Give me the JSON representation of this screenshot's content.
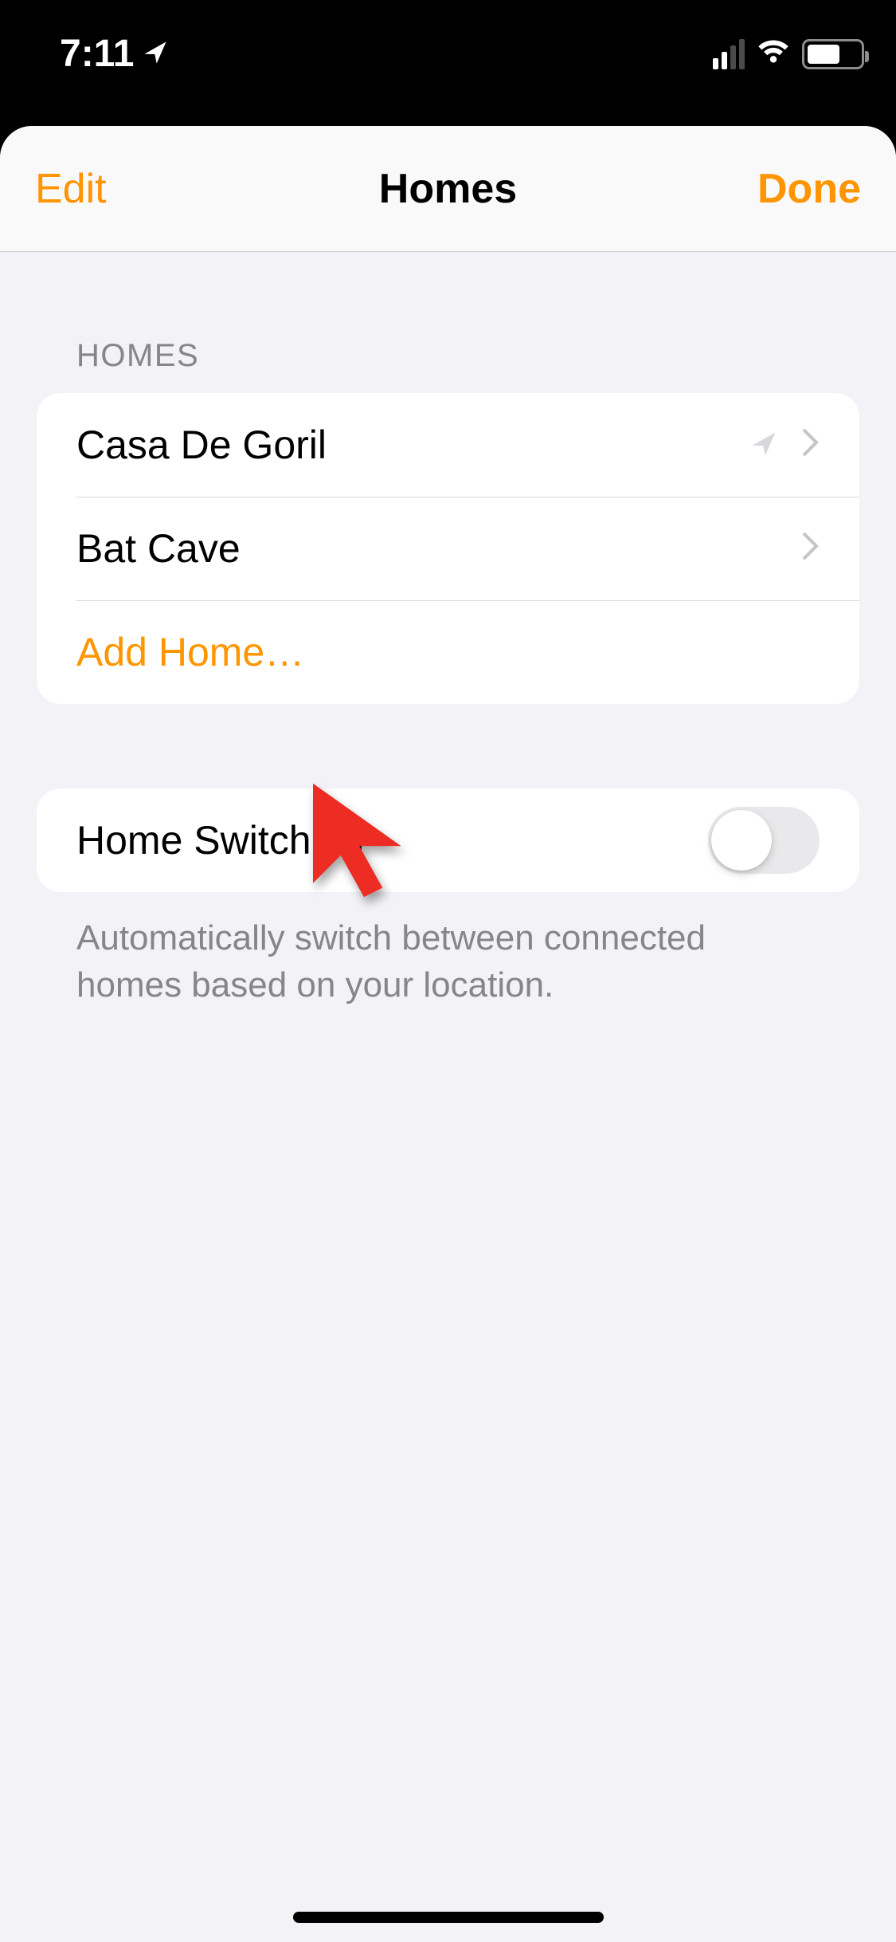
{
  "status": {
    "time": "7:11"
  },
  "nav": {
    "left": "Edit",
    "title": "Homes",
    "right": "Done"
  },
  "homes_section": {
    "header": "HOMES",
    "items": [
      {
        "label": "Casa De Goril",
        "location_indicator": true
      },
      {
        "label": "Bat Cave",
        "location_indicator": false
      }
    ],
    "add_label": "Add Home…"
  },
  "switching_section": {
    "label": "Home Switching",
    "on": false,
    "footer": "Automatically switch between connected homes based on your location."
  }
}
